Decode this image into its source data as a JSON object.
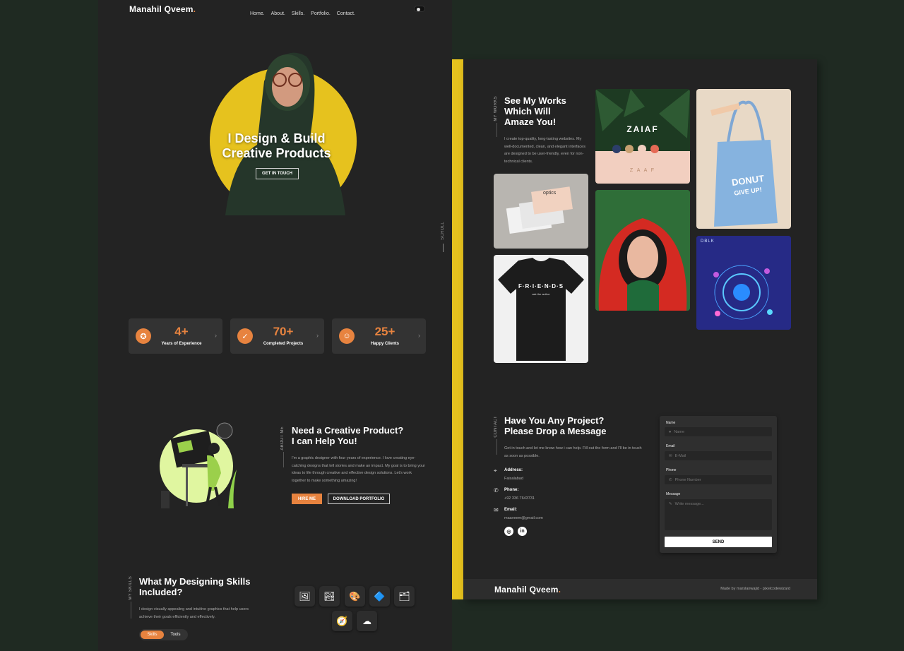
{
  "left": {
    "logo": "Manahil Qveem",
    "logo_dot": ".",
    "nav": [
      "Home.",
      "About.",
      "Skills.",
      "Portfolio.",
      "Contact."
    ],
    "hero": {
      "title_line1": "I Design & Build",
      "title_line2": "Creative Products",
      "cta": "GET IN TOUCH"
    },
    "stats": [
      {
        "value": "4+",
        "label": "Years of Experience"
      },
      {
        "value": "70+",
        "label": "Completed Projects"
      },
      {
        "value": "25+",
        "label": "Happy Clients"
      }
    ],
    "about": {
      "vlabel": "ABOUT ME",
      "title_line1": "Need a Creative Product?",
      "title_line2": "I can Help You!",
      "text": "I'm a graphic designer with four years of experience. I love creating eye-catching designs that tell stories and make an impact. My goal is to bring your ideas to life through creative and effective design solutions. Let's work together to make something amazing!",
      "hire": "HIRE ME",
      "download": "DOWNLOAD PORTFOLIO"
    },
    "skills": {
      "vlabel": "MY SKILLS",
      "title_line1": "What My Designing Skills",
      "title_line2": "Included?",
      "text": "I design visually appealing and intuitive graphics that help users achieve their goals efficiently and effectively.",
      "tab_skills": "Skills",
      "tab_tools": "Tools"
    }
  },
  "scroll_label": "SCROLL",
  "right": {
    "works": {
      "vlabel": "MY WORKS",
      "title_line1": "See My Works",
      "title_line2": "Which Will",
      "title_line3": "Amaze You!",
      "text": "I create top-quality, long-lasting websites. My well-documented, clean, and elegant interfaces are designed to be user-friendly, even for non-technical clients."
    },
    "portfolio_texts": {
      "zaiaf": "ZAIAF",
      "zaiaf_sub": "Z A A F",
      "optics": "optics",
      "friends": "F·R·I·E·N·D·S",
      "friends_sub": "ask the author",
      "donut_line1": "DONUT",
      "donut_line2": "GIVE UP!",
      "dblk": "DBLK"
    },
    "contact": {
      "vlabel": "CONTACT",
      "title_line1": "Have You Any Project?",
      "title_line2": "Please Drop a Message",
      "text": "Get in touch and let me know how i can help. Fill out the form and I'll be in touch as soon as possible.",
      "address_label": "Address:",
      "address": "Faisalabad",
      "phone_label": "Phone:",
      "phone": "+92 336 7643731",
      "email_label": "Email:",
      "email": "maaveem@gmail.com"
    },
    "form": {
      "name_label": "Name",
      "name_ph": "Name",
      "email_label": "Email",
      "email_ph": "E-Mail",
      "phone_label": "Phone",
      "phone_ph": "Phone Number",
      "message_label": "Message",
      "message_ph": "Write message...",
      "send": "SEND"
    },
    "footer": {
      "logo": "Manahil Qveem",
      "logo_dot": ".",
      "credit": "Made by marslanwajid - pixelcodewizard"
    }
  },
  "colors": {
    "accent": "#e7833f",
    "yellow": "#e6c21e",
    "page_bg": "#232323",
    "body_bg": "#1f2a22"
  }
}
